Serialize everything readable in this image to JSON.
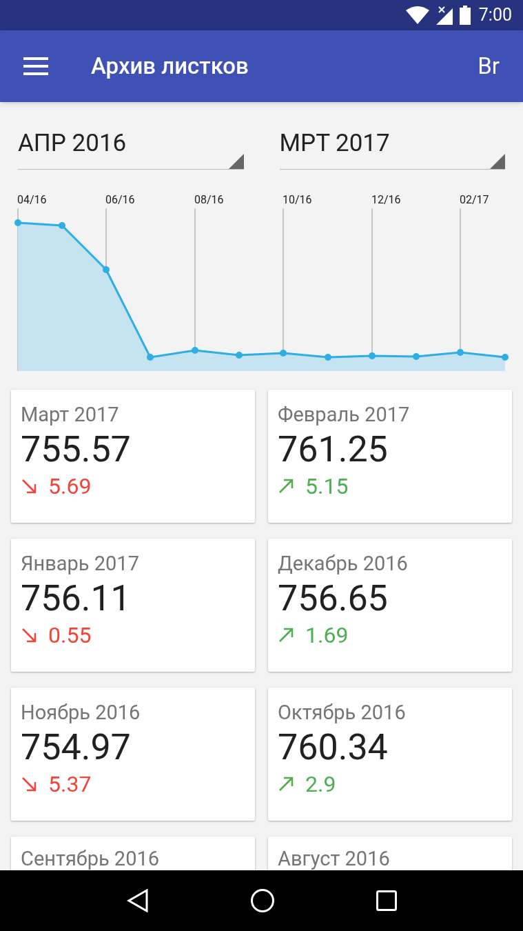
{
  "status_bar": {
    "time": "7:00"
  },
  "app_bar": {
    "title": "Архив листков",
    "action": "Br"
  },
  "range": {
    "from": "АПР 2016",
    "to": "МРТ 2017"
  },
  "chart_labels": [
    "04/16",
    "06/16",
    "08/16",
    "10/16",
    "12/16",
    "02/17"
  ],
  "cards": [
    {
      "month": "Март 2017",
      "value": "755.57",
      "rising": false,
      "change": "5.69"
    },
    {
      "month": "Февраль 2017",
      "value": "761.25",
      "rising": true,
      "change": "5.15"
    },
    {
      "month": "Январь 2017",
      "value": "756.11",
      "rising": false,
      "change": "0.55"
    },
    {
      "month": "Декабрь 2016",
      "value": "756.65",
      "rising": true,
      "change": "1.69"
    },
    {
      "month": "Ноябрь 2016",
      "value": "754.97",
      "rising": false,
      "change": "5.37"
    },
    {
      "month": "Октябрь 2016",
      "value": "760.34",
      "rising": true,
      "change": "2.9"
    },
    {
      "month": "Сентябрь 2016"
    },
    {
      "month": "Август 2016"
    }
  ]
}
